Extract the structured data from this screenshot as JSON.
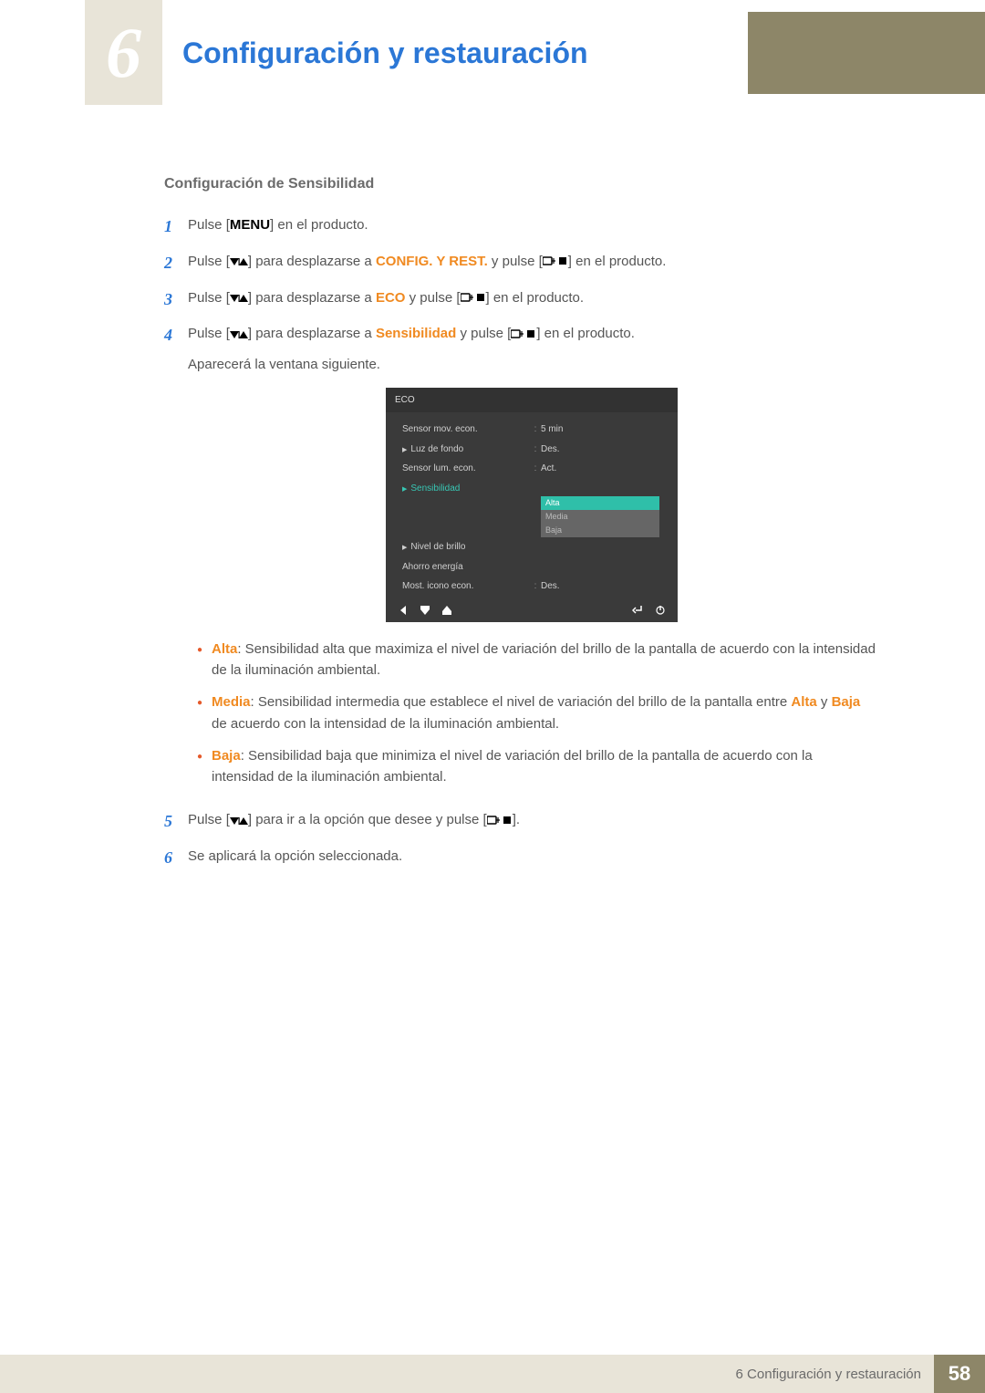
{
  "chapter_number": "6",
  "page_title": "Configuración y restauración",
  "section_title": "Configuración de Sensibilidad",
  "steps": {
    "1": "Pulse [",
    "1_menu": "MENU",
    "1_tail": "] en el producto.",
    "2_a": "Pulse [",
    "2_b": "] para desplazarse a ",
    "2_kw": "CONFIG. Y REST.",
    "2_c": " y pulse [",
    "2_d": "] en el producto.",
    "3_a": "Pulse [",
    "3_b": "] para desplazarse a ",
    "3_kw": "ECO",
    "3_c": " y pulse [",
    "3_d": "] en el producto.",
    "4_a": "Pulse [",
    "4_b": "] para desplazarse a ",
    "4_kw": "Sensibilidad",
    "4_c": " y pulse [",
    "4_d": "] en el producto.",
    "4_note": "Aparecerá la ventana siguiente.",
    "5_a": "Pulse [",
    "5_b": "] para ir a la opción que desee y pulse [",
    "5_c": "].",
    "6": "Se aplicará la opción seleccionada."
  },
  "osd": {
    "title": "ECO",
    "items": [
      {
        "label": "Sensor mov. econ.",
        "value": "5 min",
        "indent": false
      },
      {
        "label": "Luz de fondo",
        "value": "Des.",
        "indent": true
      },
      {
        "label": "Sensor lum. econ.",
        "value": "Act.",
        "indent": false
      },
      {
        "label": "Sensibilidad",
        "value": "",
        "indent": true,
        "active": true
      },
      {
        "label": "Nivel de brillo",
        "value": "",
        "indent": true
      },
      {
        "label": "Ahorro energía",
        "value": "",
        "indent": false
      },
      {
        "label": "Most. icono econ.",
        "value": "Des.",
        "indent": false
      }
    ],
    "dropdown": [
      "Alta",
      "Media",
      "Baja"
    ],
    "dropdown_selected": "Alta"
  },
  "bullets": {
    "alta_label": "Alta",
    "alta_text": ": Sensibilidad alta que maximiza el nivel de variación del brillo de la pantalla de acuerdo con la intensidad de la iluminación ambiental.",
    "media_label": "Media",
    "media_text_a": ": Sensibilidad intermedia que establece el nivel de variación del brillo de la pantalla entre ",
    "media_kw1": "Alta",
    "media_and": " y ",
    "media_kw2": "Baja",
    "media_text_b": " de acuerdo con la intensidad de la iluminación ambiental.",
    "baja_label": "Baja",
    "baja_text": ": Sensibilidad baja que minimiza el nivel de variación del brillo de la pantalla de acuerdo con la intensidad de la iluminación ambiental."
  },
  "footer": {
    "text": "6 Configuración y restauración",
    "page": "58"
  }
}
